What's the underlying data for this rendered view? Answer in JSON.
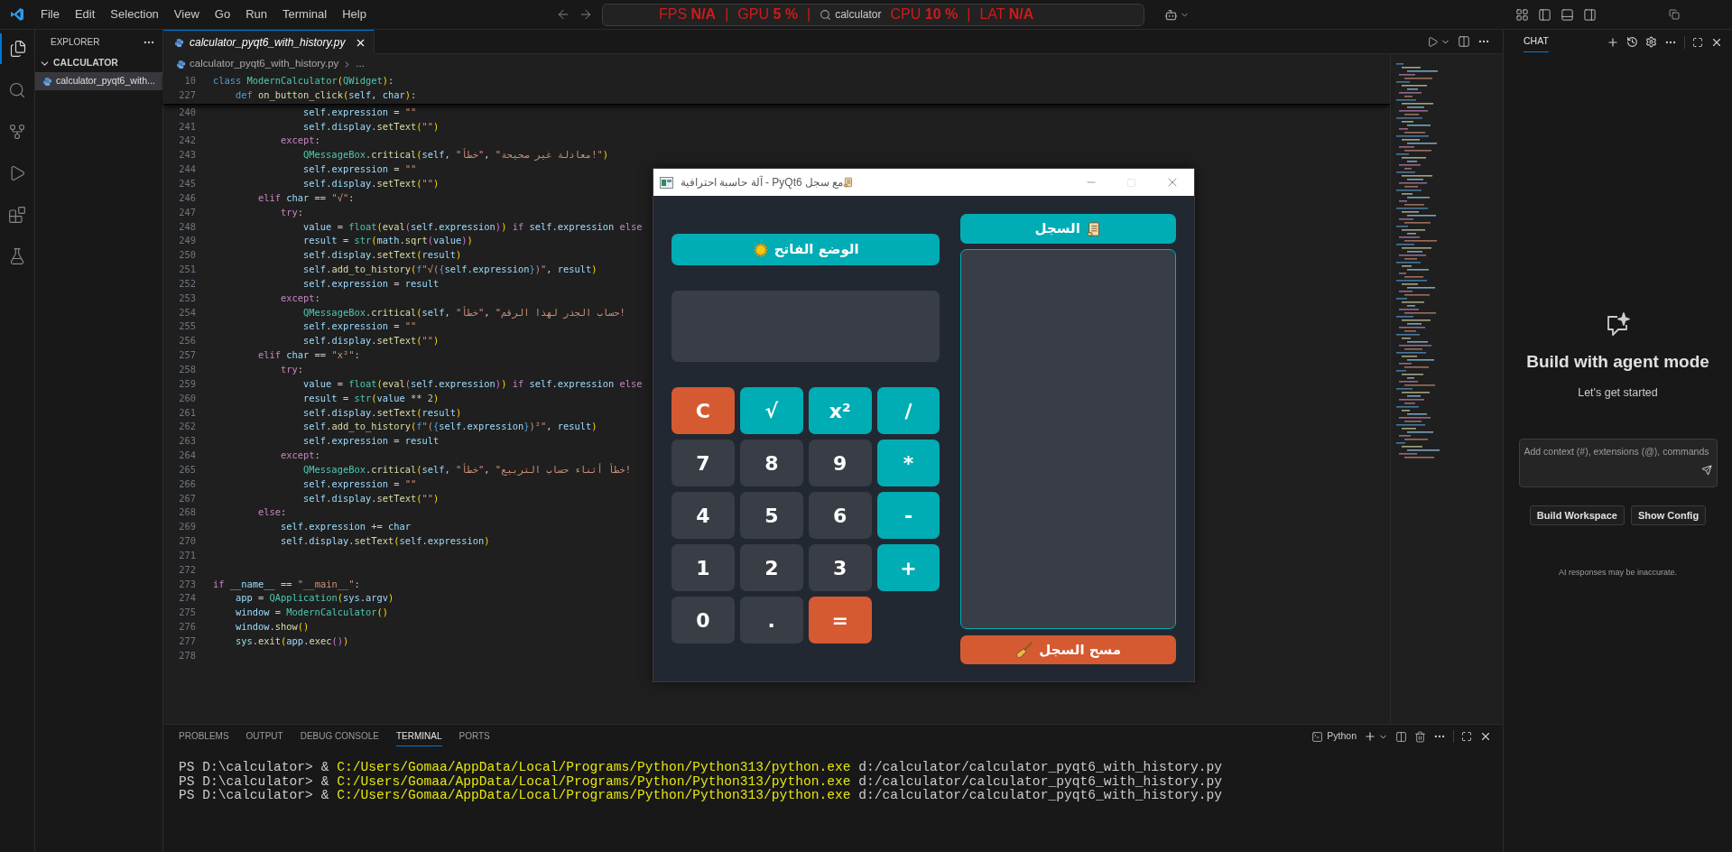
{
  "title_bar": {
    "menu": [
      "File",
      "Edit",
      "Selection",
      "View",
      "Go",
      "Run",
      "Terminal",
      "Help"
    ],
    "search": {
      "value": "calculator"
    },
    "perf_overlay": [
      {
        "label": "FPS",
        "value": "N/A",
        "separator": "|"
      },
      {
        "label": "GPU",
        "value": "5 %",
        "separator": "|"
      },
      {
        "label": "CPU",
        "value": "10 %",
        "separator": "|"
      },
      {
        "label": "LAT",
        "value": "N/A"
      }
    ]
  },
  "activity_bar": [
    {
      "kind": "explorer",
      "selected": true
    },
    {
      "kind": "search",
      "selected": false
    },
    {
      "kind": "scm",
      "selected": false
    },
    {
      "kind": "run",
      "selected": false
    },
    {
      "kind": "extensions",
      "selected": false
    },
    {
      "kind": "testing",
      "selected": false
    }
  ],
  "explorer": {
    "title": "EXPLORER",
    "folder": {
      "name": "CALCULATOR",
      "expanded": true,
      "children": [
        {
          "name": "calculator_pyqt6_with...",
          "selected": true
        }
      ]
    }
  },
  "editor": {
    "tabs": [
      {
        "label": "calculator_pyqt6_with_history.py",
        "selected": true
      }
    ],
    "breadcrumb": [
      "calculator_pyqt6_with_history.py",
      "..."
    ],
    "sticky_lines": [
      {
        "number": "10",
        "code": [
          {
            "kind": "decl",
            "text": "class "
          },
          {
            "kind": "cls",
            "text": "ModernCalculator"
          },
          {
            "kind": "b1",
            "text": "("
          },
          {
            "kind": "cls",
            "text": "QWidget"
          },
          {
            "kind": "b1",
            "text": ")"
          },
          {
            "kind": "p",
            "text": ":"
          }
        ]
      },
      {
        "number": "227",
        "code": [
          {
            "kind": "decl",
            "text": "    def "
          },
          {
            "kind": "fn",
            "text": "on_button_click"
          },
          {
            "kind": "b1",
            "text": "("
          },
          {
            "kind": "var",
            "text": "self"
          },
          {
            "kind": "p",
            "text": ", "
          },
          {
            "kind": "var",
            "text": "char"
          },
          {
            "kind": "b1",
            "text": ")"
          },
          {
            "kind": "p",
            "text": ":"
          }
        ]
      }
    ],
    "lines": [
      {
        "number": "240",
        "code": [
          {
            "kind": "var",
            "text": "                self"
          },
          {
            "kind": "p",
            "text": "."
          },
          {
            "kind": "var",
            "text": "expression"
          },
          {
            "kind": "p",
            "text": " = "
          },
          {
            "kind": "str",
            "text": "\"\""
          }
        ]
      },
      {
        "number": "241",
        "code": [
          {
            "kind": "var",
            "text": "                self"
          },
          {
            "kind": "p",
            "text": "."
          },
          {
            "kind": "var",
            "text": "display"
          },
          {
            "kind": "p",
            "text": "."
          },
          {
            "kind": "fn",
            "text": "setText"
          },
          {
            "kind": "b1",
            "text": "("
          },
          {
            "kind": "str",
            "text": "\"\""
          },
          {
            "kind": "b1",
            "text": ")"
          }
        ]
      },
      {
        "number": "242",
        "code": [
          {
            "kind": "kw",
            "text": "            except"
          },
          {
            "kind": "p",
            "text": ":"
          }
        ]
      },
      {
        "number": "243",
        "code": [
          {
            "kind": "cls",
            "text": "                QMessageBox"
          },
          {
            "kind": "p",
            "text": "."
          },
          {
            "kind": "fn",
            "text": "critical"
          },
          {
            "kind": "b1",
            "text": "("
          },
          {
            "kind": "var",
            "text": "self"
          },
          {
            "kind": "p",
            "text": ", "
          },
          {
            "kind": "str",
            "text": "\"خطأ\""
          },
          {
            "kind": "p",
            "text": ", "
          },
          {
            "kind": "str",
            "text": "\"معادلة غير صحيحة!\""
          },
          {
            "kind": "b1",
            "text": ")"
          }
        ]
      },
      {
        "number": "244",
        "code": [
          {
            "kind": "var",
            "text": "                self"
          },
          {
            "kind": "p",
            "text": "."
          },
          {
            "kind": "var",
            "text": "expression"
          },
          {
            "kind": "p",
            "text": " = "
          },
          {
            "kind": "str",
            "text": "\"\""
          }
        ]
      },
      {
        "number": "245",
        "code": [
          {
            "kind": "var",
            "text": "                self"
          },
          {
            "kind": "p",
            "text": "."
          },
          {
            "kind": "var",
            "text": "display"
          },
          {
            "kind": "p",
            "text": "."
          },
          {
            "kind": "fn",
            "text": "setText"
          },
          {
            "kind": "b1",
            "text": "("
          },
          {
            "kind": "str",
            "text": "\"\""
          },
          {
            "kind": "b1",
            "text": ")"
          }
        ]
      },
      {
        "number": "246",
        "code": [
          {
            "kind": "kw",
            "text": "        elif "
          },
          {
            "kind": "var",
            "text": "char"
          },
          {
            "kind": "p",
            "text": " == "
          },
          {
            "kind": "str",
            "text": "\"√\""
          },
          {
            "kind": "p",
            "text": ":"
          }
        ]
      },
      {
        "number": "247",
        "code": [
          {
            "kind": "kw",
            "text": "            try"
          },
          {
            "kind": "p",
            "text": ":"
          }
        ]
      },
      {
        "number": "248",
        "code": [
          {
            "kind": "var",
            "text": "                value"
          },
          {
            "kind": "p",
            "text": " = "
          },
          {
            "kind": "cls",
            "text": "float"
          },
          {
            "kind": "b1",
            "text": "("
          },
          {
            "kind": "fn",
            "text": "eval"
          },
          {
            "kind": "b2",
            "text": "("
          },
          {
            "kind": "var",
            "text": "self"
          },
          {
            "kind": "p",
            "text": "."
          },
          {
            "kind": "var",
            "text": "expression"
          },
          {
            "kind": "b2",
            "text": ")"
          },
          {
            "kind": "b1",
            "text": ")"
          },
          {
            "kind": "kw",
            "text": " if "
          },
          {
            "kind": "var",
            "text": "self"
          },
          {
            "kind": "p",
            "text": "."
          },
          {
            "kind": "var",
            "text": "expression"
          },
          {
            "kind": "kw",
            "text": " else"
          }
        ]
      },
      {
        "number": "249",
        "code": [
          {
            "kind": "var",
            "text": "                result"
          },
          {
            "kind": "p",
            "text": " = "
          },
          {
            "kind": "cls",
            "text": "str"
          },
          {
            "kind": "b1",
            "text": "("
          },
          {
            "kind": "var",
            "text": "math"
          },
          {
            "kind": "p",
            "text": "."
          },
          {
            "kind": "fn",
            "text": "sqrt"
          },
          {
            "kind": "b2",
            "text": "("
          },
          {
            "kind": "var",
            "text": "value"
          },
          {
            "kind": "b2",
            "text": ")"
          },
          {
            "kind": "b1",
            "text": ")"
          }
        ]
      },
      {
        "number": "250",
        "code": [
          {
            "kind": "var",
            "text": "                self"
          },
          {
            "kind": "p",
            "text": "."
          },
          {
            "kind": "var",
            "text": "display"
          },
          {
            "kind": "p",
            "text": "."
          },
          {
            "kind": "fn",
            "text": "setText"
          },
          {
            "kind": "b1",
            "text": "("
          },
          {
            "kind": "var",
            "text": "result"
          },
          {
            "kind": "b1",
            "text": ")"
          }
        ]
      },
      {
        "number": "251",
        "code": [
          {
            "kind": "var",
            "text": "                self"
          },
          {
            "kind": "p",
            "text": "."
          },
          {
            "kind": "fn",
            "text": "add_to_history"
          },
          {
            "kind": "b1",
            "text": "("
          },
          {
            "kind": "decl",
            "text": "f"
          },
          {
            "kind": "str",
            "text": "\"√("
          },
          {
            "kind": "decl",
            "text": "{"
          },
          {
            "kind": "var",
            "text": "self"
          },
          {
            "kind": "p",
            "text": "."
          },
          {
            "kind": "var",
            "text": "expression"
          },
          {
            "kind": "decl",
            "text": "}"
          },
          {
            "kind": "str",
            "text": ")\""
          },
          {
            "kind": "p",
            "text": ", "
          },
          {
            "kind": "var",
            "text": "result"
          },
          {
            "kind": "b1",
            "text": ")"
          }
        ]
      },
      {
        "number": "252",
        "code": [
          {
            "kind": "var",
            "text": "                self"
          },
          {
            "kind": "p",
            "text": "."
          },
          {
            "kind": "var",
            "text": "expression"
          },
          {
            "kind": "p",
            "text": " = "
          },
          {
            "kind": "var",
            "text": "result"
          }
        ]
      },
      {
        "number": "253",
        "code": [
          {
            "kind": "kw",
            "text": "            except"
          },
          {
            "kind": "p",
            "text": ":"
          }
        ]
      },
      {
        "number": "254",
        "code": [
          {
            "kind": "cls",
            "text": "                QMessageBox"
          },
          {
            "kind": "p",
            "text": "."
          },
          {
            "kind": "fn",
            "text": "critical"
          },
          {
            "kind": "b1",
            "text": "("
          },
          {
            "kind": "var",
            "text": "self"
          },
          {
            "kind": "p",
            "text": ", "
          },
          {
            "kind": "str",
            "text": "\"خطأ\""
          },
          {
            "kind": "p",
            "text": ", "
          },
          {
            "kind": "str",
            "text": "\"حساب الجذر لهذا الرقم!"
          }
        ]
      },
      {
        "number": "255",
        "code": [
          {
            "kind": "var",
            "text": "                self"
          },
          {
            "kind": "p",
            "text": "."
          },
          {
            "kind": "var",
            "text": "expression"
          },
          {
            "kind": "p",
            "text": " = "
          },
          {
            "kind": "str",
            "text": "\"\""
          }
        ]
      },
      {
        "number": "256",
        "code": [
          {
            "kind": "var",
            "text": "                self"
          },
          {
            "kind": "p",
            "text": "."
          },
          {
            "kind": "var",
            "text": "display"
          },
          {
            "kind": "p",
            "text": "."
          },
          {
            "kind": "fn",
            "text": "setText"
          },
          {
            "kind": "b1",
            "text": "("
          },
          {
            "kind": "str",
            "text": "\"\""
          },
          {
            "kind": "b1",
            "text": ")"
          }
        ]
      },
      {
        "number": "257",
        "code": [
          {
            "kind": "kw",
            "text": "        elif "
          },
          {
            "kind": "var",
            "text": "char"
          },
          {
            "kind": "p",
            "text": " == "
          },
          {
            "kind": "str",
            "text": "\"x²\""
          },
          {
            "kind": "p",
            "text": ":"
          }
        ]
      },
      {
        "number": "258",
        "code": [
          {
            "kind": "kw",
            "text": "            try"
          },
          {
            "kind": "p",
            "text": ":"
          }
        ]
      },
      {
        "number": "259",
        "code": [
          {
            "kind": "var",
            "text": "                value"
          },
          {
            "kind": "p",
            "text": " = "
          },
          {
            "kind": "cls",
            "text": "float"
          },
          {
            "kind": "b1",
            "text": "("
          },
          {
            "kind": "fn",
            "text": "eval"
          },
          {
            "kind": "b2",
            "text": "("
          },
          {
            "kind": "var",
            "text": "self"
          },
          {
            "kind": "p",
            "text": "."
          },
          {
            "kind": "var",
            "text": "expression"
          },
          {
            "kind": "b2",
            "text": ")"
          },
          {
            "kind": "b1",
            "text": ")"
          },
          {
            "kind": "kw",
            "text": " if "
          },
          {
            "kind": "var",
            "text": "self"
          },
          {
            "kind": "p",
            "text": "."
          },
          {
            "kind": "var",
            "text": "expression"
          },
          {
            "kind": "kw",
            "text": " else"
          }
        ]
      },
      {
        "number": "260",
        "code": [
          {
            "kind": "var",
            "text": "                result"
          },
          {
            "kind": "p",
            "text": " = "
          },
          {
            "kind": "cls",
            "text": "str"
          },
          {
            "kind": "b1",
            "text": "("
          },
          {
            "kind": "var",
            "text": "value"
          },
          {
            "kind": "p",
            "text": " ** "
          },
          {
            "kind": "num",
            "text": "2"
          },
          {
            "kind": "b1",
            "text": ")"
          }
        ]
      },
      {
        "number": "261",
        "code": [
          {
            "kind": "var",
            "text": "                self"
          },
          {
            "kind": "p",
            "text": "."
          },
          {
            "kind": "var",
            "text": "display"
          },
          {
            "kind": "p",
            "text": "."
          },
          {
            "kind": "fn",
            "text": "setText"
          },
          {
            "kind": "b1",
            "text": "("
          },
          {
            "kind": "var",
            "text": "result"
          },
          {
            "kind": "b1",
            "text": ")"
          }
        ]
      },
      {
        "number": "262",
        "code": [
          {
            "kind": "var",
            "text": "                self"
          },
          {
            "kind": "p",
            "text": "."
          },
          {
            "kind": "fn",
            "text": "add_to_history"
          },
          {
            "kind": "b1",
            "text": "("
          },
          {
            "kind": "decl",
            "text": "f"
          },
          {
            "kind": "str",
            "text": "\"("
          },
          {
            "kind": "decl",
            "text": "{"
          },
          {
            "kind": "var",
            "text": "self"
          },
          {
            "kind": "p",
            "text": "."
          },
          {
            "kind": "var",
            "text": "expression"
          },
          {
            "kind": "decl",
            "text": "}"
          },
          {
            "kind": "str",
            "text": ")²\""
          },
          {
            "kind": "p",
            "text": ", "
          },
          {
            "kind": "var",
            "text": "result"
          },
          {
            "kind": "b1",
            "text": ")"
          }
        ]
      },
      {
        "number": "263",
        "code": [
          {
            "kind": "var",
            "text": "                self"
          },
          {
            "kind": "p",
            "text": "."
          },
          {
            "kind": "var",
            "text": "expression"
          },
          {
            "kind": "p",
            "text": " = "
          },
          {
            "kind": "var",
            "text": "result"
          }
        ]
      },
      {
        "number": "264",
        "code": [
          {
            "kind": "kw",
            "text": "            except"
          },
          {
            "kind": "p",
            "text": ":"
          }
        ]
      },
      {
        "number": "265",
        "code": [
          {
            "kind": "cls",
            "text": "                QMessageBox"
          },
          {
            "kind": "p",
            "text": "."
          },
          {
            "kind": "fn",
            "text": "critical"
          },
          {
            "kind": "b1",
            "text": "("
          },
          {
            "kind": "var",
            "text": "self"
          },
          {
            "kind": "p",
            "text": ", "
          },
          {
            "kind": "str",
            "text": "\"خطأ\""
          },
          {
            "kind": "p",
            "text": ", "
          },
          {
            "kind": "str",
            "text": "\"خطأ أثناء حساب التربيع!"
          }
        ]
      },
      {
        "number": "266",
        "code": [
          {
            "kind": "var",
            "text": "                self"
          },
          {
            "kind": "p",
            "text": "."
          },
          {
            "kind": "var",
            "text": "expression"
          },
          {
            "kind": "p",
            "text": " = "
          },
          {
            "kind": "str",
            "text": "\"\""
          }
        ]
      },
      {
        "number": "267",
        "code": [
          {
            "kind": "var",
            "text": "                self"
          },
          {
            "kind": "p",
            "text": "."
          },
          {
            "kind": "var",
            "text": "display"
          },
          {
            "kind": "p",
            "text": "."
          },
          {
            "kind": "fn",
            "text": "setText"
          },
          {
            "kind": "b1",
            "text": "("
          },
          {
            "kind": "str",
            "text": "\"\""
          },
          {
            "kind": "b1",
            "text": ")"
          }
        ]
      },
      {
        "number": "268",
        "code": [
          {
            "kind": "kw",
            "text": "        else"
          },
          {
            "kind": "p",
            "text": ":"
          }
        ]
      },
      {
        "number": "269",
        "code": [
          {
            "kind": "var",
            "text": "            self"
          },
          {
            "kind": "p",
            "text": "."
          },
          {
            "kind": "var",
            "text": "expression"
          },
          {
            "kind": "p",
            "text": " += "
          },
          {
            "kind": "var",
            "text": "char"
          }
        ]
      },
      {
        "number": "270",
        "code": [
          {
            "kind": "var",
            "text": "            self"
          },
          {
            "kind": "p",
            "text": "."
          },
          {
            "kind": "var",
            "text": "display"
          },
          {
            "kind": "p",
            "text": "."
          },
          {
            "kind": "fn",
            "text": "setText"
          },
          {
            "kind": "b1",
            "text": "("
          },
          {
            "kind": "var",
            "text": "self"
          },
          {
            "kind": "p",
            "text": "."
          },
          {
            "kind": "var",
            "text": "expression"
          },
          {
            "kind": "b1",
            "text": ")"
          }
        ]
      },
      {
        "number": "271"
      },
      {
        "number": "272"
      },
      {
        "number": "273",
        "code": [
          {
            "kind": "kw",
            "text": "if "
          },
          {
            "kind": "var",
            "text": "__name__"
          },
          {
            "kind": "p",
            "text": " == "
          },
          {
            "kind": "str",
            "text": "\"__main__\""
          },
          {
            "kind": "p",
            "text": ":"
          }
        ]
      },
      {
        "number": "274",
        "code": [
          {
            "kind": "var",
            "text": "    app"
          },
          {
            "kind": "p",
            "text": " = "
          },
          {
            "kind": "cls",
            "text": "QApplication"
          },
          {
            "kind": "b1",
            "text": "("
          },
          {
            "kind": "var",
            "text": "sys"
          },
          {
            "kind": "p",
            "text": "."
          },
          {
            "kind": "var",
            "text": "argv"
          },
          {
            "kind": "b1",
            "text": ")"
          }
        ]
      },
      {
        "number": "275",
        "code": [
          {
            "kind": "var",
            "text": "    window"
          },
          {
            "kind": "p",
            "text": " = "
          },
          {
            "kind": "cls",
            "text": "ModernCalculator"
          },
          {
            "kind": "b1",
            "text": "()"
          }
        ]
      },
      {
        "number": "276",
        "code": [
          {
            "kind": "var",
            "text": "    window"
          },
          {
            "kind": "p",
            "text": "."
          },
          {
            "kind": "fn",
            "text": "show"
          },
          {
            "kind": "b1",
            "text": "()"
          }
        ]
      },
      {
        "number": "277",
        "code": [
          {
            "kind": "var",
            "text": "    sys"
          },
          {
            "kind": "p",
            "text": "."
          },
          {
            "kind": "fn",
            "text": "exit"
          },
          {
            "kind": "b1",
            "text": "("
          },
          {
            "kind": "var",
            "text": "app"
          },
          {
            "kind": "p",
            "text": "."
          },
          {
            "kind": "fn",
            "text": "exec"
          },
          {
            "kind": "b2",
            "text": "()"
          },
          {
            "kind": "b1",
            "text": ")"
          }
        ]
      },
      {
        "number": "278"
      }
    ]
  },
  "panel": {
    "tabs": [
      {
        "label": "PROBLEMS",
        "selected": false
      },
      {
        "label": "OUTPUT",
        "selected": false
      },
      {
        "label": "DEBUG CONSOLE",
        "selected": false
      },
      {
        "label": "TERMINAL",
        "selected": true
      },
      {
        "label": "PORTS",
        "selected": false
      }
    ],
    "shell": "Python",
    "terminal_lines": [
      {
        "prompt": "PS D:\\calculator>",
        "operator": "&",
        "command": "C:/Users/Gomaa/AppData/Local/Programs/Python/Python313/python.exe",
        "args": "d:/calculator/calculator_pyqt6_with_history.py"
      },
      {
        "prompt": "PS D:\\calculator>",
        "operator": "&",
        "command": "C:/Users/Gomaa/AppData/Local/Programs/Python/Python313/python.exe",
        "args": "d:/calculator/calculator_pyqt6_with_history.py"
      },
      {
        "prompt": "PS D:\\calculator>",
        "operator": "&",
        "command": "C:/Users/Gomaa/AppData/Local/Programs/Python/Python313/python.exe",
        "args": "d:/calculator/calculator_pyqt6_with_history.py"
      }
    ]
  },
  "chat": {
    "tab": {
      "label": "CHAT",
      "selected": true
    },
    "heading": "Build with agent mode",
    "subheading": "Let's get started",
    "input": {
      "placeholder": "Add context (#), extensions (@), commands"
    },
    "buttons": [
      "Build Workspace",
      "Show Config"
    ],
    "disclaimer": "AI responses may be inaccurate."
  },
  "calculator_window": {
    "title": "آلة حاسبة احترافية - PyQt6 مع سجل",
    "theme_button": "الوضع الفاتح",
    "keys": [
      {
        "label": "C",
        "kind": "clear"
      },
      {
        "label": "√",
        "kind": "op"
      },
      {
        "label": "x²",
        "kind": "op"
      },
      {
        "label": "/",
        "kind": "op"
      },
      {
        "label": "7",
        "kind": "digit"
      },
      {
        "label": "8",
        "kind": "digit"
      },
      {
        "label": "9",
        "kind": "digit"
      },
      {
        "label": "*",
        "kind": "op"
      },
      {
        "label": "4",
        "kind": "digit"
      },
      {
        "label": "5",
        "kind": "digit"
      },
      {
        "label": "6",
        "kind": "digit"
      },
      {
        "label": "-",
        "kind": "op"
      },
      {
        "label": "1",
        "kind": "digit"
      },
      {
        "label": "2",
        "kind": "digit"
      },
      {
        "label": "3",
        "kind": "digit"
      },
      {
        "label": "+",
        "kind": "op"
      },
      {
        "label": "0",
        "kind": "digit"
      },
      {
        "label": ".",
        "kind": "digit"
      },
      {
        "label": "=",
        "kind": "equals"
      }
    ],
    "history_title": "السجل",
    "clear_history": "مسح السجل"
  }
}
